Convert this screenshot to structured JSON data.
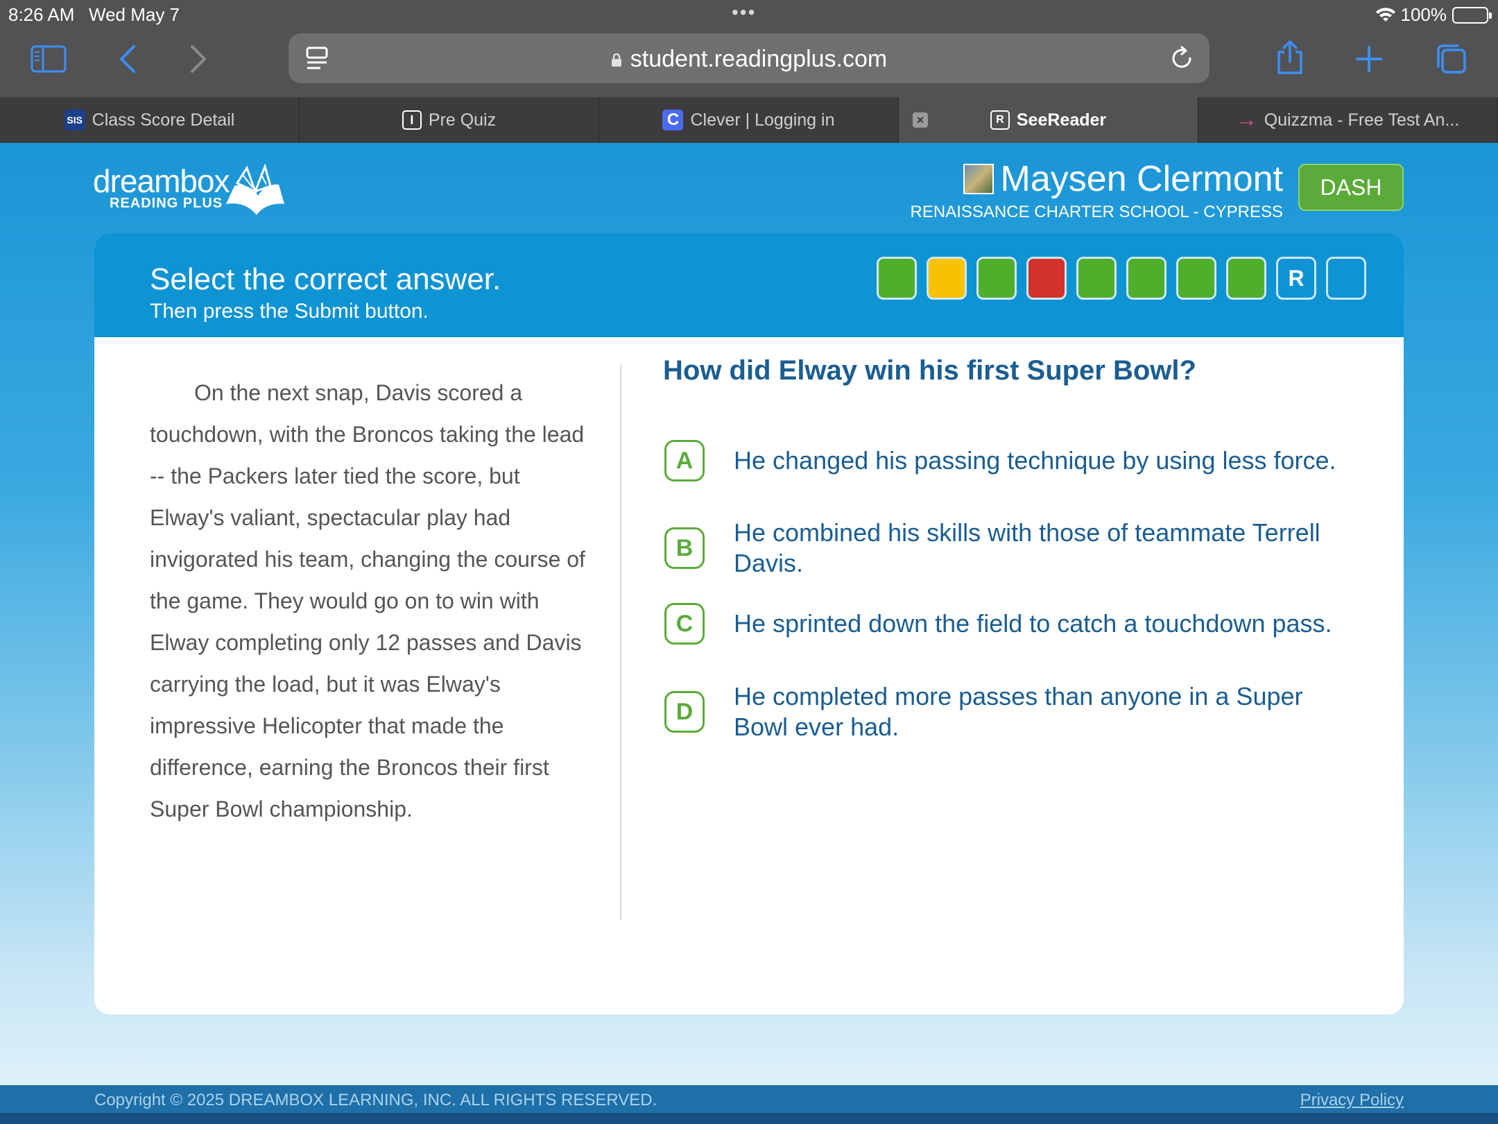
{
  "status": {
    "time": "8:26 AM",
    "date": "Wed May 7",
    "battery": "100%"
  },
  "browser": {
    "url": "student.readingplus.com",
    "tabs": [
      {
        "label": "Class Score Detail",
        "favicon": "SIS",
        "favicon_color": "#1d3f8c"
      },
      {
        "label": "Pre Quiz",
        "favicon": "I",
        "favicon_color": "#3c3c3e"
      },
      {
        "label": "Clever | Logging in",
        "favicon": "C",
        "favicon_color": "#4a6cf0"
      },
      {
        "label": "SeeReader",
        "favicon": "R",
        "favicon_color": "#3c3c3e"
      },
      {
        "label": "Quizzma - Free Test An...",
        "favicon": "→",
        "favicon_color": "#e8508a"
      }
    ]
  },
  "brand": {
    "name": "dreambox",
    "sub": "READING PLUS"
  },
  "user": {
    "name": "Maysen Clermont",
    "school": "RENAISSANCE CHARTER SCHOOL - CYPRESS"
  },
  "dash_label": "DASH",
  "instructions": {
    "main": "Select the correct answer.",
    "sub": "Then press the Submit button."
  },
  "progress": [
    {
      "label": "",
      "color": "#4fae2b"
    },
    {
      "label": "",
      "color": "#f7c200"
    },
    {
      "label": "",
      "color": "#4fae2b"
    },
    {
      "label": "",
      "color": "#d3312b"
    },
    {
      "label": "",
      "color": "#4fae2b"
    },
    {
      "label": "",
      "color": "#4fae2b"
    },
    {
      "label": "",
      "color": "#4fae2b"
    },
    {
      "label": "",
      "color": "#4fae2b"
    },
    {
      "label": "R",
      "color": "#0e93d3"
    },
    {
      "label": "",
      "color": "#0e93d3"
    }
  ],
  "passage": "On the next snap, Davis scored a touchdown, with the Broncos taking the lead -- the Packers later tied the score, but Elway's valiant, spectacular play had invigorated his team, changing the course of the game. They would go on to win with Elway completing only 12 passes and Davis carrying the load, but it was Elway's impressive Helicopter that made the difference, earning the Broncos their first Super Bowl championship.",
  "question": "How did Elway win his first Super Bowl?",
  "answers": [
    {
      "letter": "A",
      "text": "He changed his passing technique by using less force."
    },
    {
      "letter": "B",
      "text": "He combined his skills with those of teammate Terrell Davis."
    },
    {
      "letter": "C",
      "text": "He sprinted down the field to catch a touchdown pass."
    },
    {
      "letter": "D",
      "text": "He completed more passes than anyone in a Super Bowl ever had."
    }
  ],
  "footer": {
    "copyright": "Copyright © 2025 DREAMBOX LEARNING, INC. ALL RIGHTS RESERVED.",
    "privacy": "Privacy Policy"
  }
}
